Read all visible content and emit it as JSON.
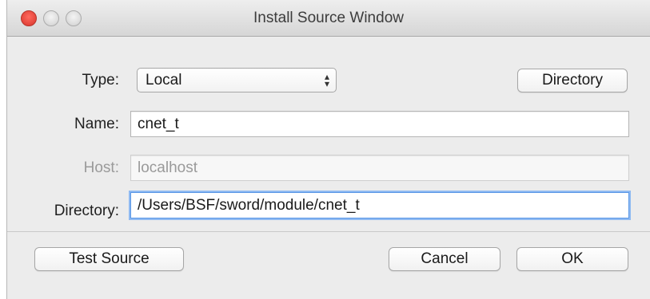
{
  "window": {
    "title": "Install Source Window"
  },
  "form": {
    "type_label": "Type:",
    "type_value": "Local",
    "directory_button": "Directory",
    "name_label": "Name:",
    "name_value": "cnet_t",
    "host_label": "Host:",
    "host_value": "localhost",
    "directory_label": "Directory:",
    "directory_value": "/Users/BSF/sword/module/cnet_t"
  },
  "footer": {
    "test_source": "Test Source",
    "cancel": "Cancel",
    "ok": "OK"
  },
  "icons": {
    "select_arrows": "⌃⌄"
  }
}
